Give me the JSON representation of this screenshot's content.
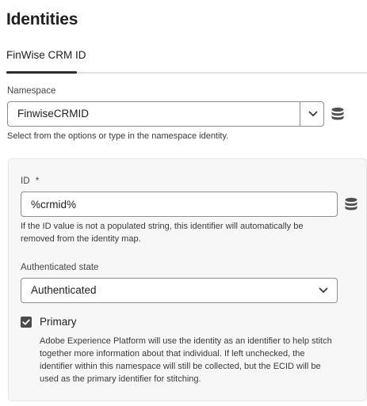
{
  "page": {
    "title": "Identities"
  },
  "tabs": [
    {
      "label": "FinWise CRM ID",
      "selected": true
    }
  ],
  "namespace": {
    "label": "Namespace",
    "value": "FinwiseCRMID",
    "help": "Select from the options or type in the namespace identity.",
    "icons": {
      "dropdown": "chevron-down-icon",
      "data_element": "database-icon"
    }
  },
  "id_field": {
    "label": "ID",
    "required_marker": "*",
    "value": "%crmid%",
    "help_line1": "If the ID value is not a populated string, this identifier will automatically be",
    "help_line2": "removed from the identity map.",
    "icons": {
      "data_element": "database-icon"
    }
  },
  "authenticated_state": {
    "label": "Authenticated state",
    "value": "Authenticated",
    "icons": {
      "dropdown": "chevron-down-icon"
    }
  },
  "primary": {
    "label": "Primary",
    "checked": true,
    "desc_line1": "Adobe Experience Platform will use the identity as an identifier to help stitch",
    "desc_line2": "together more information about that individual. If left unchecked, the",
    "desc_line3": "identifier within this namespace will still be collected, but the ECID will be",
    "desc_line4": "used as the primary identifier for stitching."
  },
  "colors": {
    "text": "#2c2c2c",
    "border": "#8e8e8e",
    "card_bg": "#f7f7f7",
    "checkbox": "#4b4b4b",
    "icon": "#505050"
  }
}
